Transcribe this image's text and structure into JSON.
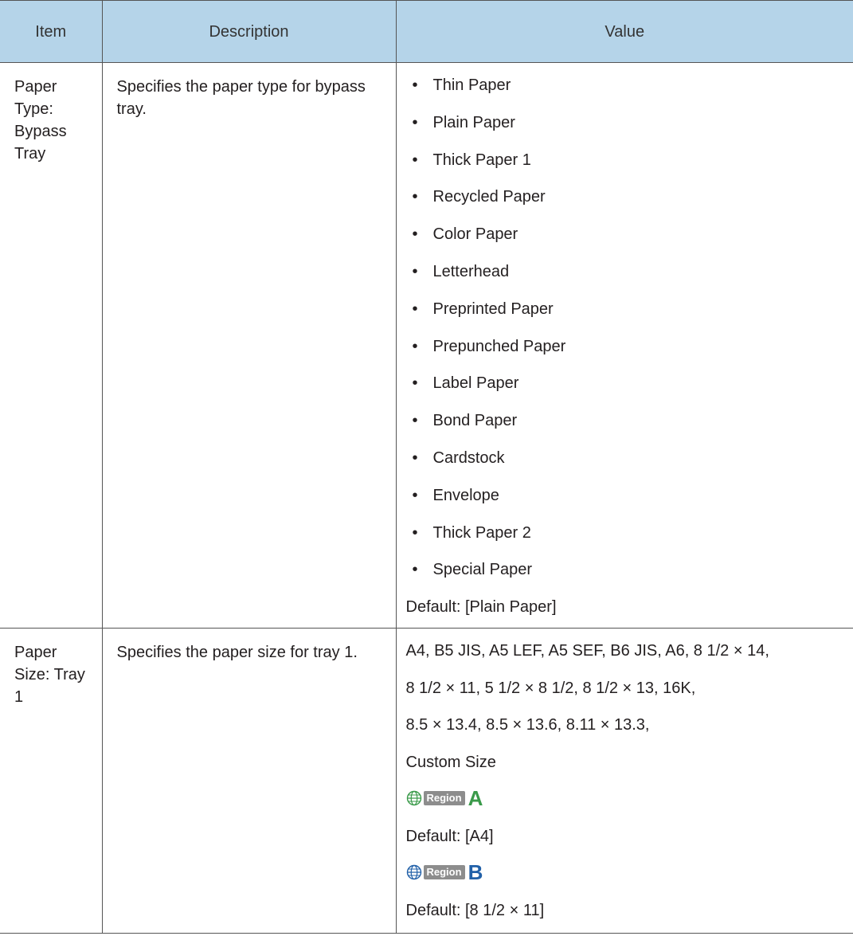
{
  "table": {
    "headers": {
      "item": "Item",
      "description": "Description",
      "value": "Value"
    },
    "row1": {
      "item": "Paper Type: Bypass Tray",
      "description": "Specifies the paper type for bypass tray.",
      "values": [
        "Thin Paper",
        "Plain Paper",
        "Thick Paper 1",
        "Recycled Paper",
        "Color Paper",
        "Letterhead",
        "Preprinted Paper",
        "Prepunched Paper",
        "Label Paper",
        "Bond Paper",
        "Cardstock",
        "Envelope",
        "Thick Paper 2",
        "Special Paper"
      ],
      "default": "Default: [Plain Paper]"
    },
    "row2": {
      "item": "Paper Size: Tray 1",
      "description": "Specifies the paper size for tray 1.",
      "sizes_lines": [
        "A4, B5 JIS, A5 LEF, A5 SEF, B6 JIS, A6, 8 1/2 × 14,",
        "8 1/2 × 11, 5 1/2 × 8 1/2, 8 1/2 × 13, 16K,",
        "8.5 × 13.4, 8.5 × 13.6, 8.11 × 13.3,",
        "Custom Size"
      ],
      "region_a": {
        "label": "Region",
        "letter": "A",
        "color": "#3a9a4a",
        "default": "Default: [A4]"
      },
      "region_b": {
        "label": "Region",
        "letter": "B",
        "color": "#2160a8",
        "default": "Default: [8 1/2 × 11]"
      }
    }
  }
}
